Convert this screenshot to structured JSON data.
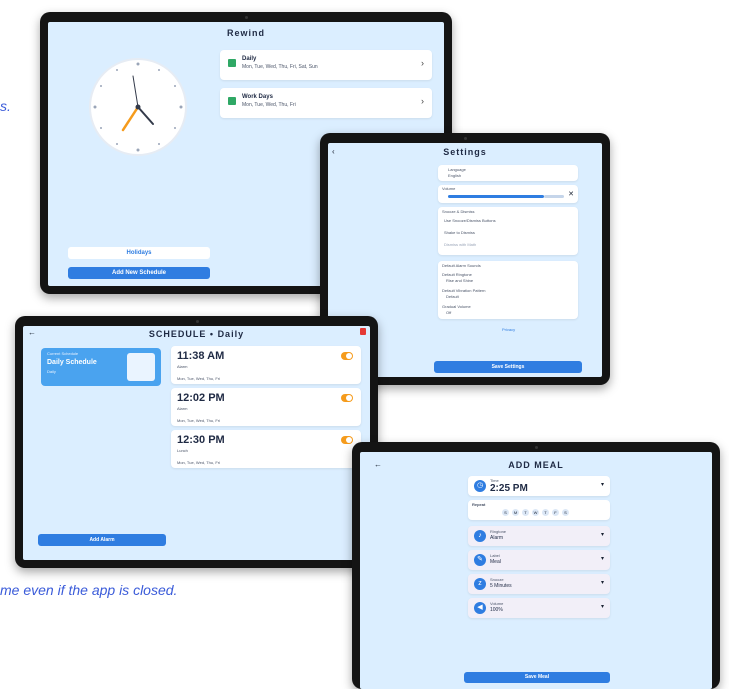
{
  "captions": {
    "top_fragment": "s.",
    "bottom_fragment": "me even if the app is closed."
  },
  "tablet_home": {
    "title": "Rewind",
    "schedules": [
      {
        "name": "Daily",
        "desc": "Mon, Tue, Wed, Thu, Fri, Sat, Sun"
      },
      {
        "name": "Work Days",
        "desc": "Mon, Tue, Wed, Thu, Fri"
      }
    ],
    "holidays_button": "Holidays",
    "add_button": "Add New Schedule"
  },
  "tablet_settings": {
    "title": "Settings",
    "language_label": "Language",
    "language_value": "English",
    "volume_label": "Volume",
    "section1_title": "Snooze & Dismiss",
    "option1": "Use Snooze/Dismiss Buttons",
    "option2": "Shake to Dismiss",
    "option3": "Dismiss with Math",
    "section2_title": "Default Alarm Sounds",
    "sound1_label": "Default Ringtone",
    "sound1_value": "Rise and Shine",
    "sound2_label": "Default Vibration Pattern",
    "sound2_value": "Default",
    "sound3_label": "Gradual Volume",
    "sound3_value": "Off",
    "link": "Privacy",
    "save_button": "Save Settings"
  },
  "tablet_schedule": {
    "title": "SCHEDULE • Daily",
    "card_label": "Current Schedule",
    "card_title": "Daily Schedule",
    "card_sub": "Daily",
    "alarms": [
      {
        "time": "11:38 AM",
        "label": "Alarm",
        "days": "Mon, Tue, Wed, Thu, Fri"
      },
      {
        "time": "12:02 PM",
        "label": "Alarm",
        "days": "Mon, Tue, Wed, Thu, Fri"
      },
      {
        "time": "12:30 PM",
        "label": "Lunch",
        "days": "Mon, Tue, Wed, Thu, Fri"
      }
    ],
    "add_button": "Add Alarm"
  },
  "tablet_add": {
    "title": "ADD MEAL",
    "time_label": "Time",
    "time_value": "2:25 PM",
    "repeat_label": "Repeat",
    "days": [
      "S",
      "M",
      "T",
      "W",
      "T",
      "F",
      "S"
    ],
    "fields": [
      {
        "label": "Ringtone",
        "value": "Alarm"
      },
      {
        "label": "Label",
        "value": "Meal"
      },
      {
        "label": "Snooze",
        "value": "5 Minutes"
      },
      {
        "label": "Volume",
        "value": "100%"
      }
    ],
    "save_button": "Save Meal"
  }
}
